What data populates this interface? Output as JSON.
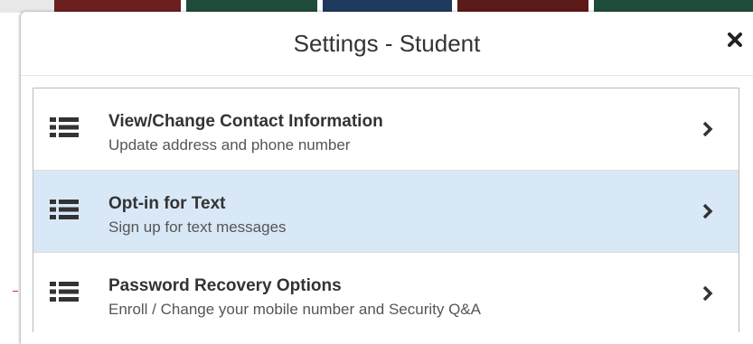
{
  "modal": {
    "title": "Settings - Student",
    "close_icon": "close-icon"
  },
  "settings": {
    "items": [
      {
        "title": "View/Change Contact Information",
        "subtitle": "Update address and phone number",
        "icon": "list-icon",
        "active": false
      },
      {
        "title": "Opt-in for Text",
        "subtitle": "Sign up for text messages",
        "icon": "list-icon",
        "active": true
      },
      {
        "title": "Password Recovery Options",
        "subtitle": "Enroll / Change your mobile number and Security Q&A",
        "icon": "list-icon",
        "active": false
      }
    ]
  },
  "colors": {
    "active_row": "#d9e8f7",
    "text": "#333333",
    "subtext": "#555555"
  }
}
